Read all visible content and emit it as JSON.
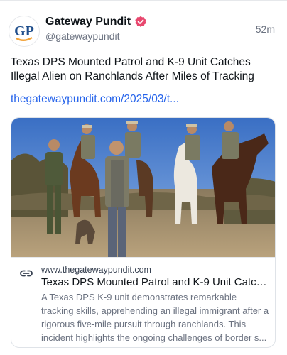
{
  "author": {
    "display_name": "Gateway Pundit",
    "handle": "@gatewaypundit",
    "avatar_text": "GP",
    "verified_icon": "verified-badge-icon"
  },
  "post": {
    "time": "52m",
    "text": "Texas DPS Mounted Patrol and K-9 Unit Catches Illegal Alien on Ranchlands After Miles of Tracking",
    "link": "thegatewaypundit.com/2025/03/t..."
  },
  "card": {
    "link_icon": "link-icon",
    "domain": "www.thegatewaypundit.com",
    "title": "Texas DPS Mounted Patrol and K-9 Unit Catch...",
    "description": "A Texas DPS K-9 unit demonstrates remarkable tracking skills, apprehending an illegal immigrant after a rigorous five-mile pursuit through ranchlands. This incident highlights the ongoing challenges of border s..."
  },
  "colors": {
    "brand_blue": "#1f4e8c",
    "brand_orange": "#f2a33a",
    "verified_pink": "#e8476e",
    "link_blue": "#2563eb",
    "muted_gray": "#6b7280"
  }
}
